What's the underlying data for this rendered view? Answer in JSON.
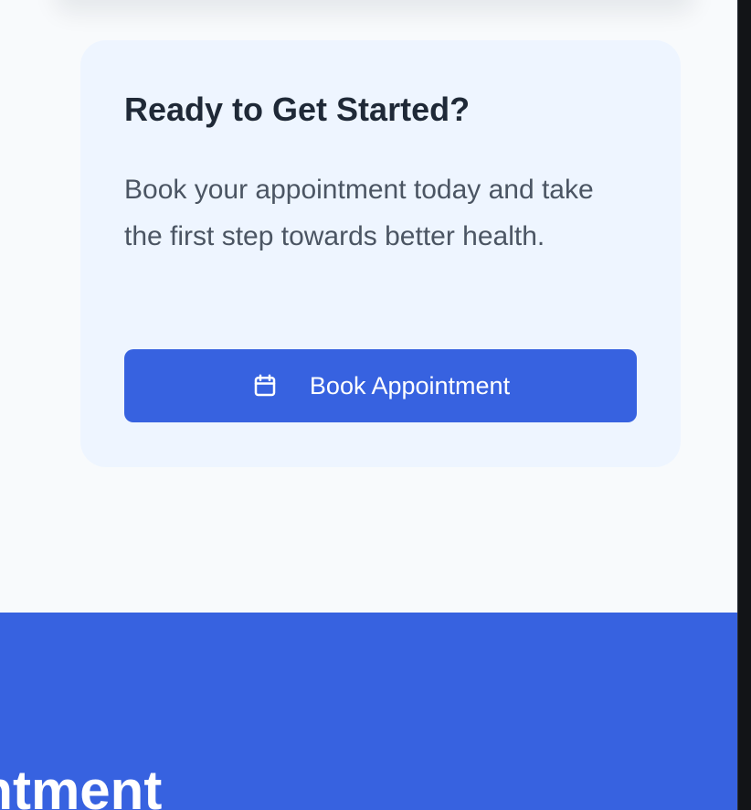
{
  "cta": {
    "title": "Ready to Get Started?",
    "description": "Book your appointment today and take the first step towards better health.",
    "button": {
      "label": "Book Appointment",
      "icon": "calendar-icon"
    }
  },
  "footer_section": {
    "heading_visible": "ointment"
  },
  "colors": {
    "page_background": "#f8fafc",
    "card_background": "#eef5ff",
    "primary": "#3762e0",
    "heading_text": "#1f2937",
    "body_text": "#4b5563",
    "button_text": "#ffffff"
  }
}
